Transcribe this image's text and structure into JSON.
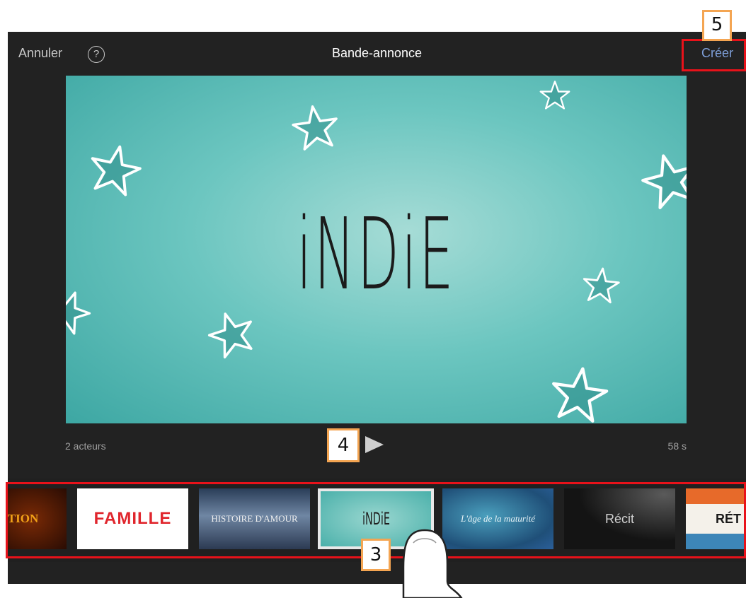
{
  "topbar": {
    "cancel_label": "Annuler",
    "help_icon": "?",
    "title": "Bande-annonce",
    "create_label": "Créer"
  },
  "preview": {
    "title_text": "iNDiE",
    "cast": "2 acteurs",
    "duration": "58 s",
    "play_icon": "play-icon"
  },
  "themes": [
    {
      "label": "TION",
      "name": "action"
    },
    {
      "label": "FAMILLE",
      "name": "famille"
    },
    {
      "label": "HISTOIRE D'AMOUR",
      "name": "histoire-d-amour"
    },
    {
      "label": "iNDiE",
      "name": "indie",
      "selected": true
    },
    {
      "label": "L'âge de la maturité",
      "name": "age-de-la-maturite"
    },
    {
      "label": "Récit",
      "name": "recit"
    },
    {
      "label": "RÉT",
      "name": "retro"
    }
  ],
  "callouts": {
    "three": "3",
    "four": "4",
    "five": "5"
  },
  "colors": {
    "accent": "#7e9fd9",
    "callout_border": "#f4a552",
    "highlight": "#e8121a",
    "background": "#222222"
  }
}
